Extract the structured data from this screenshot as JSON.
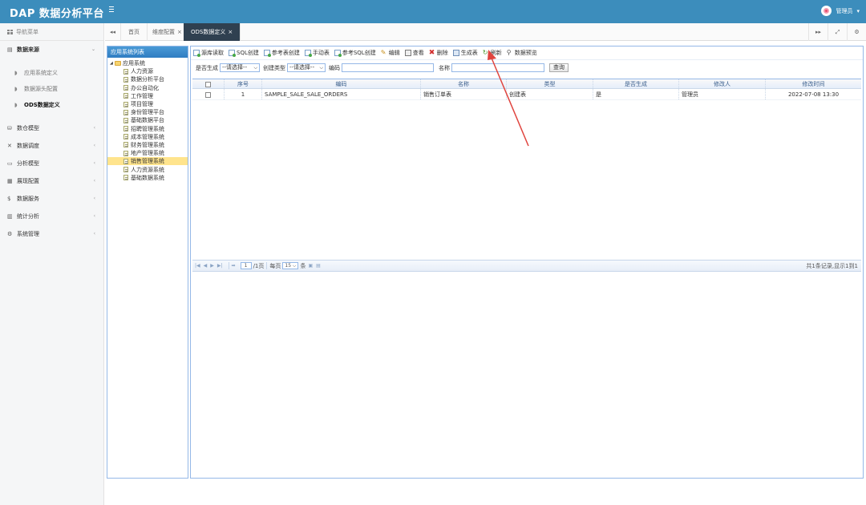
{
  "header": {
    "brand": "DAP 数据分析平台",
    "user": "管理员",
    "user_caret": "▾"
  },
  "sidebar": {
    "title": "导航菜单",
    "groups": [
      {
        "label": "数据来源",
        "icon": "database-icon",
        "open": true,
        "children": [
          "应用系统定义",
          "数据源头配置",
          "ODS数据定义"
        ]
      },
      {
        "label": "数仓模型",
        "icon": "layers-icon"
      },
      {
        "label": "数据调度",
        "icon": "shuffle-icon"
      },
      {
        "label": "分析模型",
        "icon": "monitor-icon"
      },
      {
        "label": "展现配置",
        "icon": "layout-icon"
      },
      {
        "label": "数据服务",
        "icon": "dollar-icon"
      },
      {
        "label": "统计分析",
        "icon": "bar-chart-icon"
      },
      {
        "label": "系统管理",
        "icon": "gear-icon"
      }
    ],
    "chevron_open": "⌄",
    "chevron_closed": "‹"
  },
  "tabs": {
    "nav_left": "◂◂",
    "items": [
      {
        "label": "首页"
      },
      {
        "label": "维度配置",
        "close": "×"
      },
      {
        "label": "ODS数据定义",
        "close": "×",
        "active": true
      }
    ],
    "tools": [
      "▸▸",
      "⤢",
      "⚙"
    ]
  },
  "tree": {
    "title": "应用系统列表",
    "root": "应用系统",
    "children": [
      "人力资源",
      "数据分析平台",
      "办公自动化",
      "工作管理",
      "项目管理",
      "身份管理平台",
      "基础数据平台",
      "招聘管理系统",
      "成本管理系统",
      "财务管理系统",
      "地产管理系统",
      "销售管理系统",
      "人力资源系统",
      "基础数据系统"
    ],
    "selected": "销售管理系统"
  },
  "toolbar": {
    "buttons": [
      {
        "label": "源库读取",
        "icon": "doc-add-icon"
      },
      {
        "label": "SQL创建",
        "icon": "doc-add-icon"
      },
      {
        "label": "参考表创建",
        "icon": "doc-add-icon"
      },
      {
        "label": "手动表",
        "icon": "doc-add-icon"
      },
      {
        "label": "参考SQL创建",
        "icon": "doc-add-icon"
      },
      {
        "label": "编辑",
        "icon": "pencil-icon"
      },
      {
        "label": "查看",
        "icon": "view-icon"
      },
      {
        "label": "删除",
        "icon": "delete-icon"
      },
      {
        "label": "生成表",
        "icon": "generate-icon"
      },
      {
        "label": "刷新",
        "icon": "refresh-icon"
      },
      {
        "label": "数据预览",
        "icon": "search-icon"
      }
    ]
  },
  "filters": {
    "generated_label": "是否生成",
    "generated_value": "--请选择--",
    "create_type_label": "创建类型",
    "create_type_value": "--请选择--",
    "code_label": "编码",
    "code_value": "",
    "name_label": "名称",
    "name_value": "",
    "query_button": "查询"
  },
  "grid": {
    "columns": [
      "序号",
      "编码",
      "名称",
      "类型",
      "是否生成",
      "修改人",
      "修改时间"
    ],
    "rows": [
      {
        "index": "1",
        "code": "SAMPLE_SALE_SALE_ORDERS",
        "name": "销售订单表",
        "type": "创建表",
        "generated": "是",
        "modifier": "管理员",
        "modified_time": "2022-07-08 13:30"
      }
    ]
  },
  "pager": {
    "current_page": "1",
    "total_pages": "/1页",
    "per_page_label": "每页",
    "per_page_value": "15",
    "per_page_suffix": "条",
    "summary": "共1条记录,显示1到1"
  },
  "colors": {
    "header_bg": "#3c8dbc",
    "active_tab_bg": "#2f4050",
    "selected_tree_bg": "#ffe48d",
    "annotation_arrow": "#e0443e"
  }
}
